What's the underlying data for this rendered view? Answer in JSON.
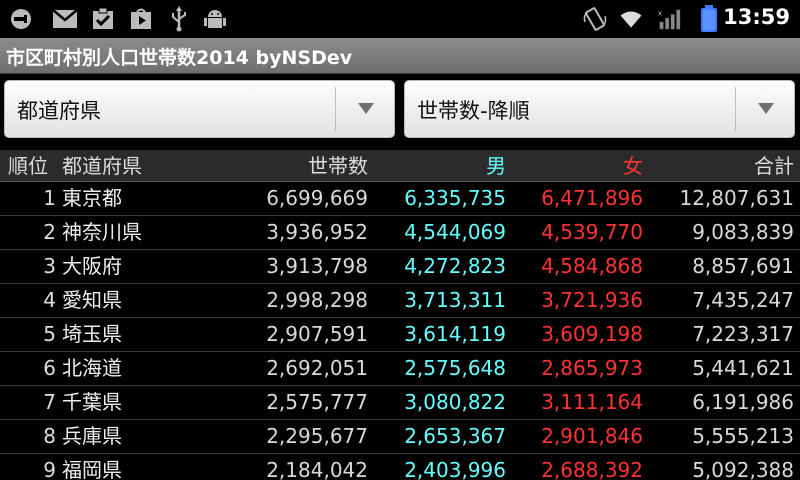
{
  "status_bar": {
    "time": "13:59",
    "icons": [
      "usb-debug-icon",
      "gmail-icon",
      "task-check-icon",
      "play-store-icon",
      "usb-icon",
      "android-icon",
      "rotation-icon",
      "wifi-icon",
      "signal-icon",
      "battery-icon"
    ],
    "battery_color": "#3d7cff"
  },
  "app": {
    "title": "市区町村別人口世帯数2014 byNSDev"
  },
  "spinners": {
    "region": "都道府県",
    "sort": "世帯数-降順"
  },
  "table": {
    "headers": {
      "rank": "順位",
      "prefecture": "都道府県",
      "households": "世帯数",
      "male": "男",
      "female": "女",
      "total": "合計"
    },
    "rows": [
      {
        "rank": "1",
        "prefecture": "東京都",
        "households": "6,699,669",
        "male": "6,335,735",
        "female": "6,471,896",
        "total": "12,807,631"
      },
      {
        "rank": "2",
        "prefecture": "神奈川県",
        "households": "3,936,952",
        "male": "4,544,069",
        "female": "4,539,770",
        "total": "9,083,839"
      },
      {
        "rank": "3",
        "prefecture": "大阪府",
        "households": "3,913,798",
        "male": "4,272,823",
        "female": "4,584,868",
        "total": "8,857,691"
      },
      {
        "rank": "4",
        "prefecture": "愛知県",
        "households": "2,998,298",
        "male": "3,713,311",
        "female": "3,721,936",
        "total": "7,435,247"
      },
      {
        "rank": "5",
        "prefecture": "埼玉県",
        "households": "2,907,591",
        "male": "3,614,119",
        "female": "3,609,198",
        "total": "7,223,317"
      },
      {
        "rank": "6",
        "prefecture": "北海道",
        "households": "2,692,051",
        "male": "2,575,648",
        "female": "2,865,973",
        "total": "5,441,621"
      },
      {
        "rank": "7",
        "prefecture": "千葉県",
        "households": "2,575,777",
        "male": "3,080,822",
        "female": "3,111,164",
        "total": "6,191,986"
      },
      {
        "rank": "8",
        "prefecture": "兵庫県",
        "households": "2,295,677",
        "male": "2,653,367",
        "female": "2,901,846",
        "total": "5,555,213"
      },
      {
        "rank": "9",
        "prefecture": "福岡県",
        "households": "2,184,042",
        "male": "2,403,996",
        "female": "2,688,392",
        "total": "5,092,388"
      }
    ]
  },
  "colors": {
    "male": "#66ffff",
    "female": "#ff3333"
  }
}
